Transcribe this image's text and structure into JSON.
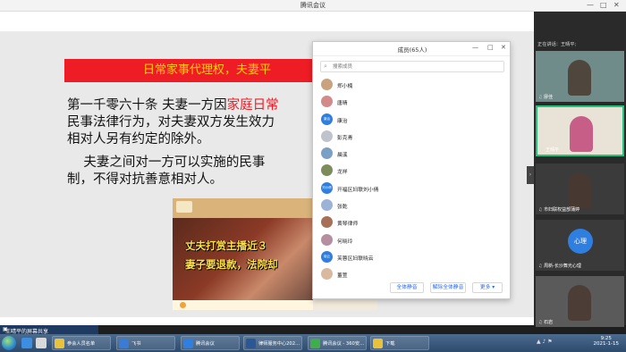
{
  "window": {
    "title": "腾讯会议",
    "minimize": "—",
    "maximize": "□",
    "close": "✕"
  },
  "slide": {
    "banner": "日常家事代理权，夫妻平",
    "lines": [
      {
        "before": "第一千零六十条  夫妻一方因",
        "highlight": "家庭日常",
        "after": ""
      },
      {
        "before": "民事法律行为，对夫妻双方发生效力",
        "highlight": "",
        "after": ""
      },
      {
        "before": "相对人另有约定的除外。",
        "highlight": "",
        "after": ""
      },
      {
        "before": "    夫妻之间对一方可以实施的民事",
        "highlight": "",
        "after": ""
      },
      {
        "before": "制，不得对抗善意相对人。",
        "highlight": "",
        "after": ""
      }
    ],
    "video_caption_1": "丈夫打赏主播近３",
    "video_caption_2": "妻子要退款，法院却"
  },
  "members_panel": {
    "title": "成员(65人)",
    "search_placeholder": "搜索成员",
    "members": [
      {
        "name": "郑小楠",
        "avatar_color": "#c9a27e",
        "avatar_text": ""
      },
      {
        "name": "唐晴",
        "avatar_color": "#d28a8a",
        "avatar_text": ""
      },
      {
        "name": "康治",
        "avatar_color": "#2f7fe0",
        "avatar_text": "康治"
      },
      {
        "name": "彭克青",
        "avatar_color": "#bfc4cc",
        "avatar_text": ""
      },
      {
        "name": "晨溪",
        "avatar_color": "#7aa0c4",
        "avatar_text": ""
      },
      {
        "name": "龙祥",
        "avatar_color": "#7c8c5a",
        "avatar_text": ""
      },
      {
        "name": "开福区妇联刘小倩",
        "avatar_color": "#2f7fe0",
        "avatar_text": "刘小倩"
      },
      {
        "name": "张乾",
        "avatar_color": "#9ab3d6",
        "avatar_text": ""
      },
      {
        "name": "黄琴律师",
        "avatar_color": "#a76f55",
        "avatar_text": ""
      },
      {
        "name": "何晓玲",
        "avatar_color": "#b58ea0",
        "avatar_text": ""
      },
      {
        "name": "芙蓉区妇联晓云",
        "avatar_color": "#2f7fe0",
        "avatar_text": "晓云"
      },
      {
        "name": "董萱",
        "avatar_color": "#d9b9a0",
        "avatar_text": ""
      }
    ],
    "btn_mute_all": "全体静音",
    "btn_unmute_all": "解除全体静音",
    "btn_more": "更多 ▾"
  },
  "video_panel": {
    "speaking_label": "正在讲话：王晴平;",
    "tiles": [
      {
        "name": "廖佳",
        "kind": "person",
        "active": false
      },
      {
        "name": "王晴平",
        "kind": "person",
        "active": true
      },
      {
        "name": "市妇联权益部蒲婷",
        "kind": "person",
        "active": false
      },
      {
        "name": "周新-长沙舞光心理",
        "kind": "circle",
        "circle_text": "心理",
        "active": false
      },
      {
        "name": "石岩",
        "kind": "person",
        "active": false
      }
    ]
  },
  "sharer": {
    "label": "王晴平的屏幕共享"
  },
  "taskbar": {
    "tasks": [
      {
        "label": "参会人员名单",
        "color": "#e8c23a"
      },
      {
        "label": "飞书",
        "color": "#3a7bd5"
      },
      {
        "label": "腾讯会议",
        "color": "#2f7fe0"
      },
      {
        "label": "律师服务中心202…",
        "color": "#2b5797"
      },
      {
        "label": "腾讯会议 - 360安…",
        "color": "#3fae4a"
      },
      {
        "label": "下载",
        "color": "#e8c23a"
      }
    ],
    "time": "9:25",
    "date": "2021-1-15"
  }
}
